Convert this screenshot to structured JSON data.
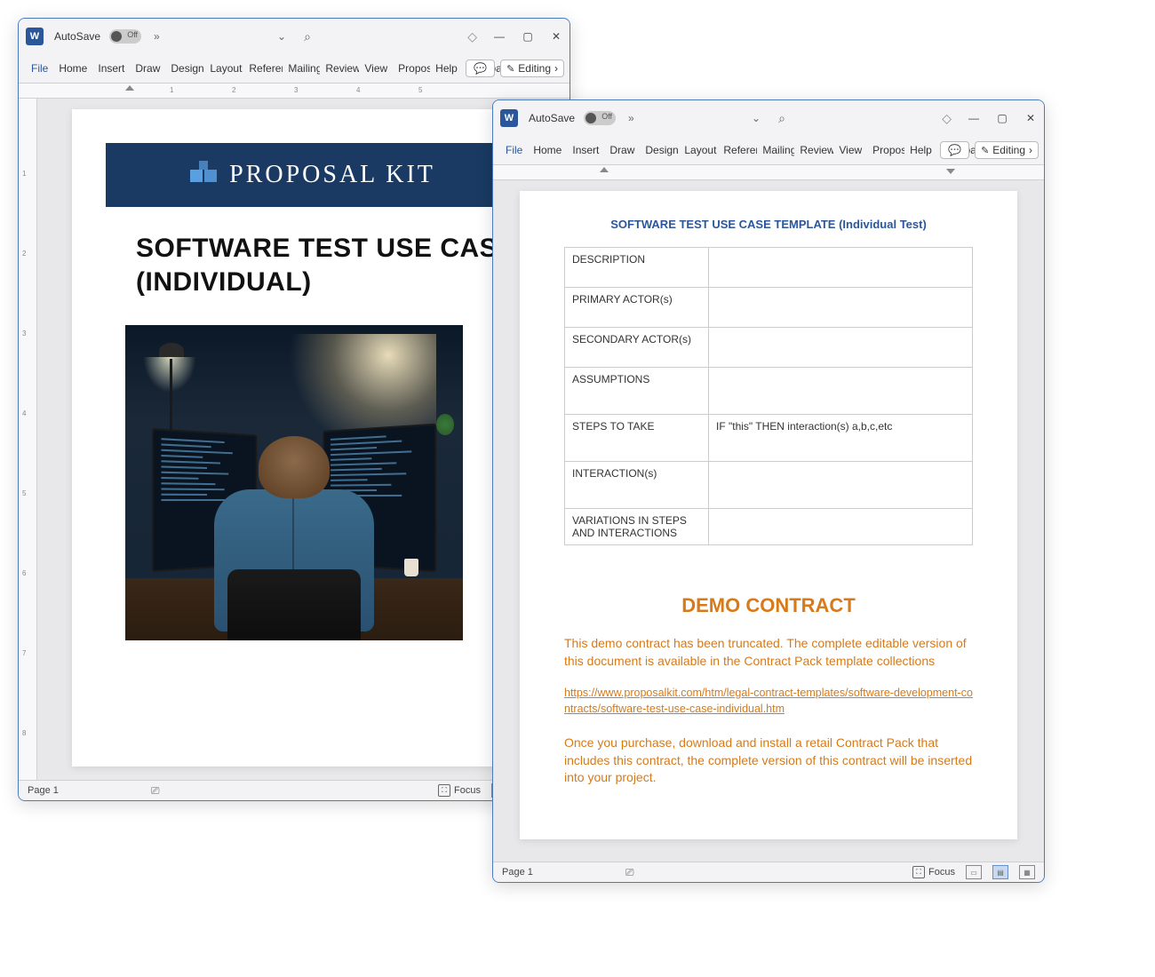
{
  "app": {
    "autosave_label": "AutoSave",
    "autosave_state": "Off",
    "editing_label": "Editing"
  },
  "ribbon_tabs": [
    "File",
    "Home",
    "Insert",
    "Draw",
    "Design",
    "Layout",
    "References",
    "Mailings",
    "Review",
    "View",
    "Proposal",
    "Help",
    "Acrobat"
  ],
  "ruler_marks": [
    "1",
    "2",
    "3",
    "4",
    "5"
  ],
  "vruler_marks": [
    "1",
    "2",
    "3",
    "4",
    "5",
    "6",
    "7",
    "8"
  ],
  "statusbar": {
    "page": "Page 1",
    "focus": "Focus"
  },
  "win1": {
    "banner_text": "PROPOSAL KIT",
    "title_line1": "SOFTWARE TEST USE CASE",
    "title_line2": "(INDIVIDUAL)"
  },
  "win2": {
    "template_title": "SOFTWARE TEST USE CASE TEMPLATE (Individual Test)",
    "rows": [
      {
        "label": "DESCRIPTION",
        "value": ""
      },
      {
        "label": "PRIMARY ACTOR(s)",
        "value": ""
      },
      {
        "label": "SECONDARY ACTOR(s)",
        "value": ""
      },
      {
        "label": "ASSUMPTIONS",
        "value": ""
      },
      {
        "label": "STEPS TO TAKE",
        "value": "IF \"this\" THEN interaction(s) a,b,c,etc"
      },
      {
        "label": "INTERACTION(s)",
        "value": ""
      },
      {
        "label": "VARIATIONS IN STEPS AND INTERACTIONS",
        "value": ""
      }
    ],
    "demo_heading": "DEMO CONTRACT",
    "demo_p1": "This demo contract has been truncated. The complete editable version of this document is available in the Contract Pack template collections",
    "demo_link": "https://www.proposalkit.com/htm/legal-contract-templates/software-development-contracts/software-test-use-case-individual.htm",
    "demo_p2": "Once you purchase, download and install a retail Contract Pack that includes this contract, the complete version of this contract will be inserted into your project."
  }
}
